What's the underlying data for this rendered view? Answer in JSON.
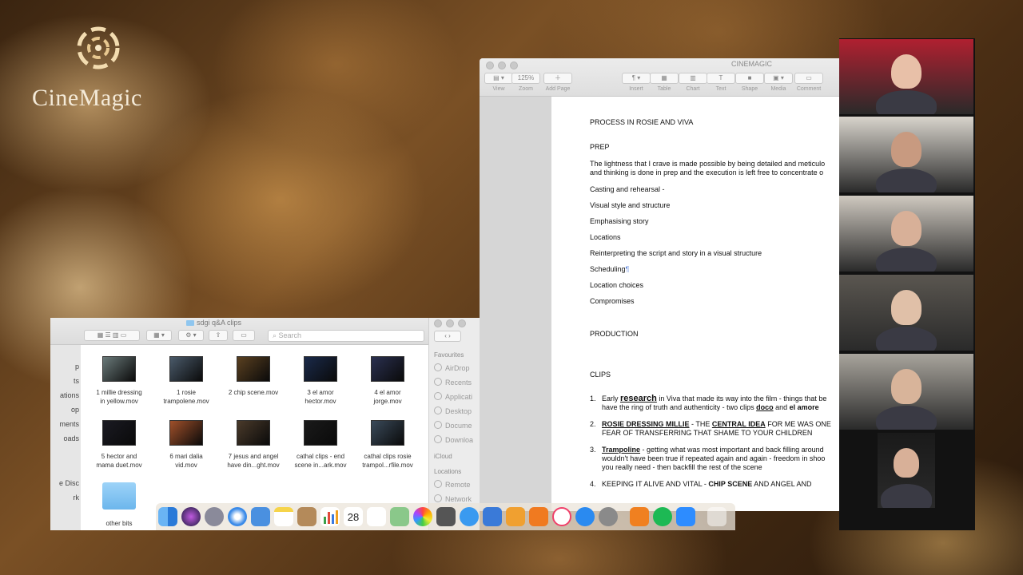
{
  "logo": {
    "text": "CineMagic",
    "icon": "cinemagic-swirl-icon"
  },
  "pages_window": {
    "title": "CINEMAGIC",
    "toolbar": [
      {
        "icon": "view-icon",
        "label": "View"
      },
      {
        "icon": "zoom-icon",
        "value": "125%",
        "label": "Zoom"
      },
      {
        "icon": "add-page-icon",
        "label": "Add Page"
      },
      {
        "icon": "insert-icon",
        "label": "Insert"
      },
      {
        "icon": "table-icon",
        "label": "Table"
      },
      {
        "icon": "chart-icon",
        "label": "Chart"
      },
      {
        "icon": "text-icon",
        "label": "Text"
      },
      {
        "icon": "shape-icon",
        "label": "Shape"
      },
      {
        "icon": "media-icon",
        "label": "Media"
      },
      {
        "icon": "comment-icon",
        "label": "Comment"
      }
    ],
    "doc": {
      "heading": "PROCESS IN ROSIE AND VIVA",
      "prep": "PREP",
      "intro_1": "The lightness that I crave is made possible by being detailed and meticulo",
      "intro_2": "and thinking is done in prep and the execution is left free to concentrate o",
      "items": [
        "Casting and rehearsal -",
        "Visual style and structure",
        "Emphasising story",
        "Locations",
        "Reinterpreting the script and story in a visual structure",
        "Scheduling",
        "Location choices",
        "Compromises"
      ],
      "production": "PRODUCTION",
      "clips": "CLIPS",
      "list": {
        "n1": "1.",
        "l1_a": "Early ",
        "l1_b": "research",
        "l1_c": " in Viva that made its way into the film - things that be",
        "l1_d": "have the ring of truth and authenticity - two clips ",
        "l1_e": "doco",
        "l1_f": " and ",
        "l1_g": "el amore",
        "n2": "2.",
        "l2_a": "ROSIE DRESSING MILLIE",
        "l2_b": " - THE ",
        "l2_c": "CENTRAL IDEA",
        "l2_d": " FOR ME WAS ONE",
        "l2_e": "FEAR OF TRANSFERRING THAT SHAME TO YOUR CHILDREN",
        "n3": "3.",
        "l3_a": "Trampoline",
        "l3_b": " - getting what was most important and back filling around",
        "l3_c": "wouldn't have been true if repeated again and again - freedom in shoo",
        "l3_d": "you really need - then backfill the rest of the scene",
        "n4": "4.",
        "l4_a": "KEEPING IT ALIVE AND VITAL - ",
        "l4_b": "CHIP SCENE",
        "l4_c": " AND ANGEL AND"
      }
    }
  },
  "finder": {
    "title": "sdgi q&A clips",
    "search_placeholder": "Search",
    "left_fragments": [
      "p",
      "ts",
      "ations",
      "op",
      "ments",
      "oads",
      "e Disc",
      "rk"
    ],
    "files": [
      {
        "l1": "1 millie dressing",
        "l2": "in yellow.mov",
        "tone": "#6a7a7a"
      },
      {
        "l1": "1 rosie",
        "l2": "trampolene.mov",
        "tone": "#4a5a6a"
      },
      {
        "l1": "2 chip scene.mov",
        "l2": "",
        "tone": "#5a4020"
      },
      {
        "l1": "3 el amor",
        "l2": "hector.mov",
        "tone": "#1a2a4a"
      },
      {
        "l1": "4 el amor",
        "l2": "jorge.mov",
        "tone": "#2a3050"
      },
      {
        "l1": "5 hector and",
        "l2": "mama duet.mov",
        "tone": "#1a1a22"
      },
      {
        "l1": "6 mari dalia",
        "l2": "vid.mov",
        "tone": "#a0502a"
      },
      {
        "l1": "7 jesus and angel",
        "l2": "have din...ght.mov",
        "tone": "#4a3a2a"
      },
      {
        "l1": "cathal clips - end",
        "l2": "scene in...ark.mov",
        "tone": "#1a1a1a"
      },
      {
        "l1": "cathal clips rosie",
        "l2": "trampol...rfile.mov",
        "tone": "#3a4a5a"
      },
      {
        "l1": "other bits",
        "l2": "",
        "tone": "folder"
      }
    ],
    "sidebar": {
      "favourites": "Favourites",
      "items": [
        "AirDrop",
        "Recents",
        "Applicati",
        "Desktop",
        "Docume",
        "Downloa"
      ],
      "icloud": "iCloud",
      "locations": "Locations",
      "loc_items": [
        "Remote",
        "Network"
      ]
    }
  },
  "dock": {
    "calendar_day": "28",
    "apps": [
      "finder-icon",
      "siri-icon",
      "launchpad-icon",
      "safari-icon",
      "mail-icon",
      "notes-icon",
      "contacts-icon",
      "numbers-icon",
      "calendar-icon",
      "reminders-icon",
      "maps-icon",
      "photos-icon",
      "calculator-icon",
      "messages-icon",
      "keynote-icon",
      "pages-icon",
      "books-icon",
      "music-icon",
      "app-store-icon",
      "system-preferences-icon",
      "vlc-icon",
      "spotify-icon",
      "zoom-icon",
      "trash-icon"
    ]
  },
  "zoom_gallery": {
    "participants": [
      {
        "bg": "#b02030",
        "face": "#e8c0a8"
      },
      {
        "bg": "#d8d4cc",
        "face": "#c89a80"
      },
      {
        "bg": "#cfc9c0",
        "face": "#d8b098"
      },
      {
        "bg": "#5a5650",
        "face": "#e0c0a8"
      },
      {
        "bg": "#a8a49c",
        "face": "#d8b49a"
      },
      {
        "bg": "#1a1a1a",
        "face": "#d8b098"
      }
    ]
  }
}
